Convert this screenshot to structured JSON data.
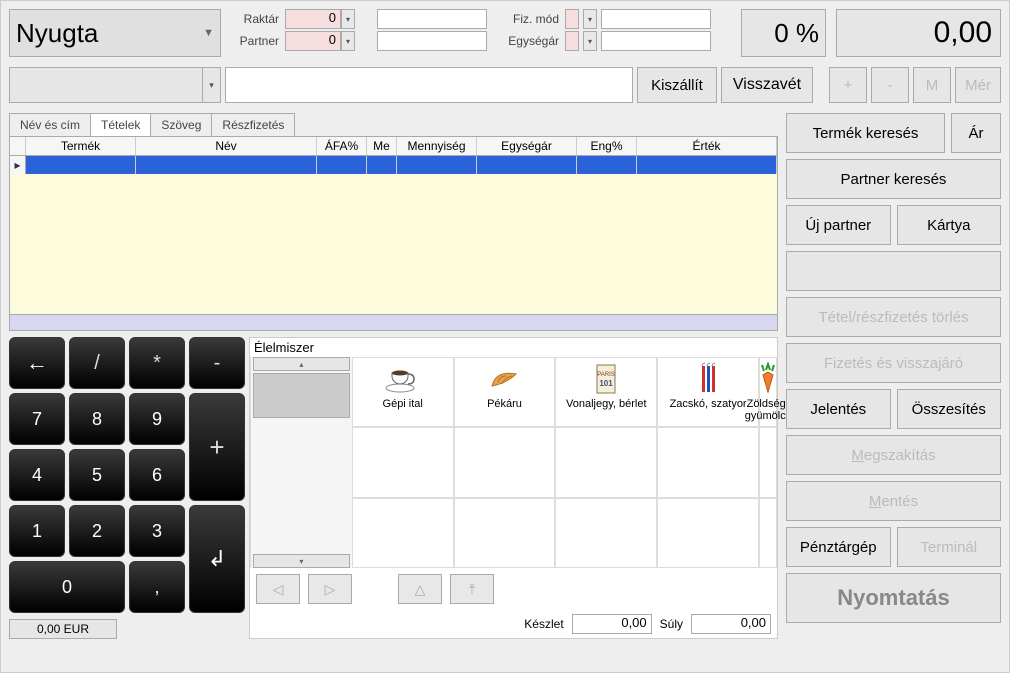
{
  "doc_type": "Nyugta",
  "fields": {
    "raktar_label": "Raktár",
    "raktar_value": "0",
    "partner_label": "Partner",
    "partner_value": "0",
    "fizmod_label": "Fiz. mód",
    "egysegar_label": "Egységár"
  },
  "pct_display": "0 %",
  "total_display": "0,00",
  "row2_buttons": {
    "kiszallit": "Kiszállít",
    "visszavet": "Visszavét",
    "plus": "+",
    "minus": "-",
    "m": "M",
    "mer": "Mér"
  },
  "tabs": [
    "Név és cím",
    "Tételek",
    "Szöveg",
    "Részfizetés"
  ],
  "active_tab": 1,
  "columns": {
    "termek": "Termék",
    "nev": "Név",
    "afa": "ÁFA%",
    "me": "Me",
    "menny": "Mennyiség",
    "ear": "Egységár",
    "eng": "Eng%",
    "ertek": "Érték"
  },
  "keypad": {
    "back": "←",
    "slash": "/",
    "star": "*",
    "minus": "-",
    "plus": "+",
    "seven": "7",
    "eight": "8",
    "nine": "9",
    "four": "4",
    "five": "5",
    "six": "6",
    "one": "1",
    "two": "2",
    "three": "3",
    "zero": "0",
    "comma": ",",
    "enter": "↲"
  },
  "products_section_title": "Élelmiszer",
  "products": [
    {
      "name": "Gépi ital",
      "icon": "coffee"
    },
    {
      "name": "Pékáru",
      "icon": "croissant"
    },
    {
      "name": "Vonaljegy, bérlet",
      "icon": "ticket"
    },
    {
      "name": "Zacskó, szatyor",
      "icon": "bag"
    },
    {
      "name": "Zöldség-gyümölcs",
      "icon": "carrot"
    }
  ],
  "right_buttons": {
    "termek_kereses": "Termék keresés",
    "ar": "Ár",
    "partner_kereses": "Partner keresés",
    "uj_partner": "Új partner",
    "kartya": "Kártya",
    "tetel_torles": "Tétel/részfizetés törlés",
    "fizetes": "Fizetés és visszajáró",
    "jelentes": "Jelentés",
    "osszesites": "Összesítés",
    "megszakitas_pre": "M",
    "megszakitas_post": "egszakítás",
    "mentes_pre": "M",
    "mentes_post": "entés",
    "penztargep": "Pénztárgép",
    "terminal": "Terminál",
    "nyomtatas": "Nyomtatás"
  },
  "status": {
    "eur": "0,00 EUR",
    "keszlet_label": "Készlet",
    "keszlet_value": "0,00",
    "suly_label": "Súly",
    "suly_value": "0,00"
  }
}
